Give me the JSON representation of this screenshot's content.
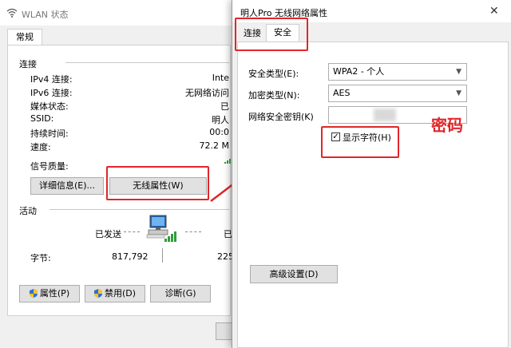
{
  "back_window": {
    "title": "WLAN 状态",
    "tab_label": "常规",
    "connection": {
      "group_title": "连接",
      "rows": [
        {
          "label": "IPv4 连接:",
          "value": "Inte"
        },
        {
          "label": "IPv6 连接:",
          "value": "无网络访问"
        },
        {
          "label": "媒体状态:",
          "value": "已"
        },
        {
          "label": "SSID:",
          "value": "明人"
        },
        {
          "label": "持续时间:",
          "value": "00:0"
        },
        {
          "label": "速度:",
          "value": "72.2 M"
        }
      ],
      "signal_label": "信号质量:",
      "details_button": "详细信息(E)...",
      "wireless_props_button": "无线属性(W)"
    },
    "activity": {
      "group_title": "活动",
      "sent_label": "已发送",
      "received_label": "已",
      "bytes_label": "字节:",
      "bytes_sent": "817,792",
      "bytes_received": "225"
    },
    "buttons": {
      "properties": "属性(P)",
      "disable": "禁用(D)",
      "diagnose": "诊断(G)"
    }
  },
  "front_window": {
    "title": "明人Pro 无线网络属性",
    "tabs": [
      {
        "label": "连接"
      },
      {
        "label": "安全"
      }
    ],
    "security_type_label": "安全类型(E):",
    "security_type_value": "WPA2 - 个人",
    "encryption_type_label": "加密类型(N):",
    "encryption_type_value": "AES",
    "network_key_label": "网络安全密钥(K)",
    "show_chars_label": "显示字符(H)",
    "show_chars_checked": true,
    "advanced_button": "高级设置(D)"
  },
  "annotation": {
    "password_text": "密码",
    "color": "#e0262a"
  }
}
